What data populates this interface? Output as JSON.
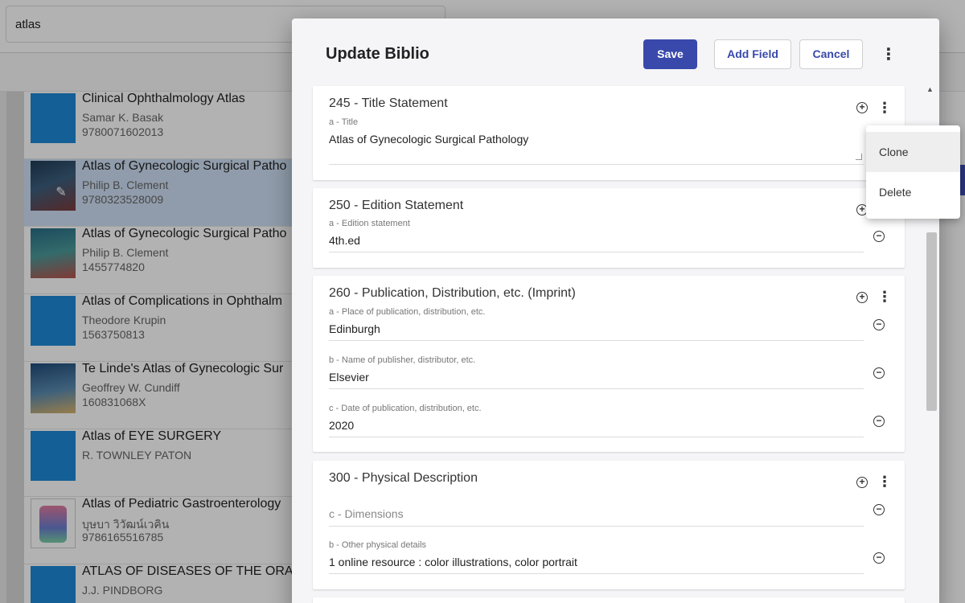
{
  "search": {
    "value": "atlas"
  },
  "books": [
    {
      "title": "Clinical Ophthalmology Atlas",
      "author": "Samar K. Basak",
      "isbn": "9780071602013"
    },
    {
      "title": "Atlas of Gynecologic Surgical Patho",
      "author": "Philip B. Clement",
      "isbn": "9780323528009"
    },
    {
      "title": "Atlas of Gynecologic Surgical Patho",
      "author": "Philip B. Clement",
      "isbn": "1455774820"
    },
    {
      "title": "Atlas of Complications in Ophthalm",
      "author": "Theodore Krupin",
      "isbn": "1563750813"
    },
    {
      "title": "Te Linde's Atlas of Gynecologic Sur",
      "author": "Geoffrey W. Cundiff",
      "isbn": "160831068X"
    },
    {
      "title": "Atlas of EYE SURGERY",
      "author": "R. TOWNLEY PATON",
      "isbn": ""
    },
    {
      "title": "Atlas of Pediatric Gastroenterology",
      "author": "บุษบา วิวัฒน์เวคิน",
      "isbn": "9786165516785"
    },
    {
      "title": "ATLAS OF DISEASES OF THE ORAL",
      "author": "J.J. PINDBORG",
      "isbn": ""
    }
  ],
  "dialog": {
    "title": "Update Biblio",
    "save_label": "Save",
    "add_field_label": "Add Field",
    "cancel_label": "Cancel"
  },
  "fields": [
    {
      "title": "245 - Title Statement",
      "subfields": [
        {
          "label": "a - Title",
          "value": "Atlas of Gynecologic Surgical Pathology"
        }
      ]
    },
    {
      "title": "250 - Edition Statement",
      "subfields": [
        {
          "label": "a - Edition statement",
          "value": "4th.ed"
        }
      ]
    },
    {
      "title": "260 - Publication, Distribution, etc. (Imprint)",
      "subfields": [
        {
          "label": "a - Place of publication, distribution, etc.",
          "value": "Edinburgh"
        },
        {
          "label": "b - Name of publisher, distributor, etc.",
          "value": "Elsevier"
        },
        {
          "label": "c - Date of publication, distribution, etc.",
          "value": "2020"
        }
      ]
    },
    {
      "title": "300 - Physical Description",
      "subfields": [
        {
          "label": "",
          "placeholder": "c - Dimensions",
          "value": ""
        },
        {
          "label": "b - Other physical details",
          "value": "1 online resource : color illustrations, color portrait"
        }
      ]
    }
  ],
  "context_menu": {
    "items": [
      "Clone",
      "Delete"
    ]
  },
  "icons": {
    "add": "add-circle-icon",
    "remove": "remove-circle-icon",
    "more": "more-vert-icon",
    "edit": "edit-pencil-icon"
  },
  "colors": {
    "primary": "#3949ab",
    "selected_row": "#cfe0f5",
    "cover_blue": "#1e88d6"
  }
}
